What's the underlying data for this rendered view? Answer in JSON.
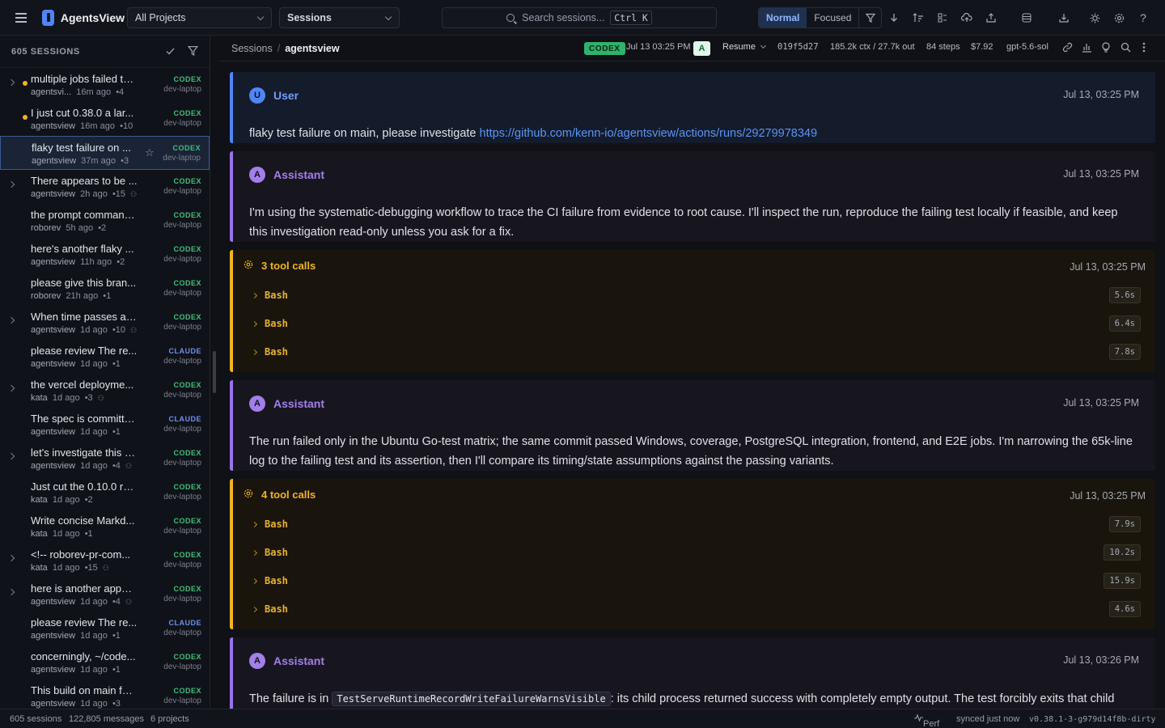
{
  "app": {
    "name": "AgentsView"
  },
  "topbar": {
    "project_select": "All Projects",
    "view_select": "Sessions",
    "search_placeholder": "Search sessions...",
    "search_shortcut": "Ctrl K",
    "mode_normal": "Normal",
    "mode_focused": "Focused"
  },
  "sidebar": {
    "count_label": "605 SESSIONS",
    "sessions": [
      {
        "title": "multiple jobs failed th...",
        "project": "agentsvi...",
        "age": "16m ago",
        "count": "4",
        "agent": "CODEX",
        "host": "dev-laptop"
      },
      {
        "title": "I just cut 0.38.0 a lar...",
        "project": "agentsview",
        "age": "16m ago",
        "count": "10",
        "agent": "CODEX",
        "host": "dev-laptop"
      },
      {
        "title": "flaky test failure on ...",
        "project": "agentsview",
        "age": "37m ago",
        "count": "3",
        "agent": "CODEX",
        "host": "dev-laptop"
      },
      {
        "title": "There appears to be ...",
        "project": "agentsview",
        "age": "2h ago",
        "count": "15",
        "agent": "CODEX",
        "host": "dev-laptop"
      },
      {
        "title": "the prompt command...",
        "project": "roborev",
        "age": "5h ago",
        "count": "2",
        "agent": "CODEX",
        "host": "dev-laptop"
      },
      {
        "title": "here's another flaky ...",
        "project": "agentsview",
        "age": "11h ago",
        "count": "2",
        "agent": "CODEX",
        "host": "dev-laptop"
      },
      {
        "title": "please give this bran...",
        "project": "roborev",
        "age": "21h ago",
        "count": "1",
        "agent": "CODEX",
        "host": "dev-laptop"
      },
      {
        "title": "When time passes an...",
        "project": "agentsview",
        "age": "1d ago",
        "count": "10",
        "agent": "CODEX",
        "host": "dev-laptop"
      },
      {
        "title": "please review The re...",
        "project": "agentsview",
        "age": "1d ago",
        "count": "1",
        "agent": "CLAUDE",
        "host": "dev-laptop"
      },
      {
        "title": "the vercel deployme...",
        "project": "kata",
        "age": "1d ago",
        "count": "3",
        "agent": "CODEX",
        "host": "dev-laptop"
      },
      {
        "title": "The spec is committe...",
        "project": "agentsview",
        "age": "1d ago",
        "count": "1",
        "agent": "CLAUDE",
        "host": "dev-laptop"
      },
      {
        "title": "let's investigate this c...",
        "project": "agentsview",
        "age": "1d ago",
        "count": "4",
        "agent": "CODEX",
        "host": "dev-laptop"
      },
      {
        "title": "Just cut the 0.10.0 re...",
        "project": "kata",
        "age": "1d ago",
        "count": "2",
        "agent": "CODEX",
        "host": "dev-laptop"
      },
      {
        "title": "Write concise Markd...",
        "project": "kata",
        "age": "1d ago",
        "count": "1",
        "agent": "CODEX",
        "host": "dev-laptop"
      },
      {
        "title": "<!-- roborev-pr-com...",
        "project": "kata",
        "age": "1d ago",
        "count": "15",
        "agent": "CODEX",
        "host": "dev-laptop"
      },
      {
        "title": "here is another appar...",
        "project": "agentsview",
        "age": "1d ago",
        "count": "4",
        "agent": "CODEX",
        "host": "dev-laptop"
      },
      {
        "title": "please review The re...",
        "project": "agentsview",
        "age": "1d ago",
        "count": "1",
        "agent": "CLAUDE",
        "host": "dev-laptop"
      },
      {
        "title": "concerningly, ~/code...",
        "project": "agentsview",
        "age": "1d ago",
        "count": "1",
        "agent": "CODEX",
        "host": "dev-laptop"
      },
      {
        "title": "This build on main fai...",
        "project": "agentsview",
        "age": "1d ago",
        "count": "3",
        "agent": "CODEX",
        "host": "dev-laptop"
      }
    ]
  },
  "header": {
    "breadcrumb_root": "Sessions",
    "breadcrumb_current": "agentsview",
    "agent_badge": "CODEX",
    "started": "Jul 13 03:25 PM",
    "avatar_letter": "A",
    "resume_label": "Resume",
    "session_id": "019f5d27",
    "tokens": "185.2k ctx / 27.7k out",
    "steps": "84 steps",
    "cost": "$7.92",
    "model": "gpt-5.6-sol"
  },
  "messages": {
    "user": {
      "avatar": "U",
      "role": "User",
      "time": "Jul 13, 03:25 PM",
      "text": "flaky test failure on main, please investigate ",
      "link": "https://github.com/kenn-io/agentsview/actions/runs/29279978349"
    },
    "assistant1": {
      "avatar": "A",
      "role": "Assistant",
      "time": "Jul 13, 03:25 PM",
      "text": "I'm using the systematic-debugging workflow to trace the CI failure from evidence to root cause. I'll inspect the run, reproduce the failing test locally if feasible, and keep this investigation read-only unless you ask for a fix."
    },
    "tools1": {
      "label": "3 tool calls",
      "time": "Jul 13, 03:25 PM",
      "calls": [
        {
          "name": "Bash",
          "duration": "5.6s"
        },
        {
          "name": "Bash",
          "duration": "6.4s"
        },
        {
          "name": "Bash",
          "duration": "7.8s"
        }
      ]
    },
    "assistant2": {
      "avatar": "A",
      "role": "Assistant",
      "time": "Jul 13, 03:25 PM",
      "text": "The run failed only in the Ubuntu Go-test matrix; the same commit passed Windows, coverage, PostgreSQL integration, frontend, and E2E jobs. I'm narrowing the 65k-line log to the failing test and its assertion, then I'll compare its timing/state assumptions against the passing variants."
    },
    "tools2": {
      "label": "4 tool calls",
      "time": "Jul 13, 03:25 PM",
      "calls": [
        {
          "name": "Bash",
          "duration": "7.9s"
        },
        {
          "name": "Bash",
          "duration": "10.2s"
        },
        {
          "name": "Bash",
          "duration": "15.9s"
        },
        {
          "name": "Bash",
          "duration": "4.6s"
        }
      ]
    },
    "assistant3": {
      "avatar": "A",
      "role": "Assistant",
      "time": "Jul 13, 03:26 PM",
      "text_before": "The failure is in ",
      "code": "TestServeRuntimeRecordWriteFailureWarnsVisible",
      "text_after": ": its child process returned success with completely empty output. The test forcibly exits that child after a fixed one-second sleep, so the leading hypothesis is that Ubuntu CI occasionally takes longer than one second to reach the injected runtime-record write. I'm"
    }
  },
  "statusbar": {
    "sessions": "605 sessions",
    "messages": "122,805 messages",
    "projects": "6 projects",
    "perf": "Perf",
    "sync": "synced just now",
    "version": "v0.38.1-3-g979d14f8b-dirty"
  },
  "colors": {
    "accent_blue": "#4f86f7",
    "assistant_purple": "#9b74e8",
    "tool_amber": "#f2b41d",
    "codex_green": "#2fb36b"
  }
}
